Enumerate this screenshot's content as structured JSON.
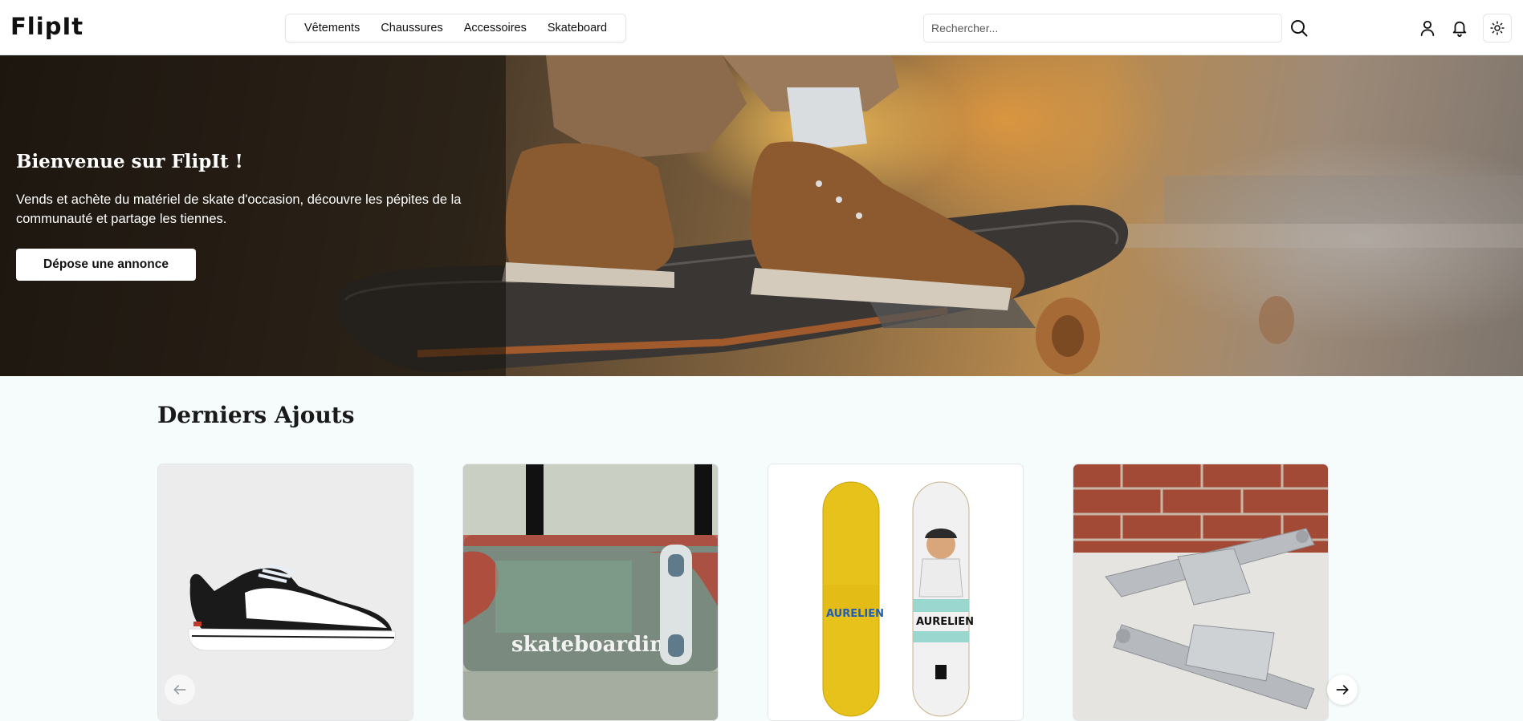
{
  "header": {
    "logo": "FlipIt",
    "nav": [
      "Vêtements",
      "Chaussures",
      "Accessoires",
      "Skateboard"
    ],
    "search": {
      "placeholder": "Rechercher..."
    },
    "icons": [
      "search-icon",
      "user-icon",
      "bell-icon",
      "sun-icon"
    ]
  },
  "hero": {
    "title": "Bienvenue sur FlipIt !",
    "text": "Vends et achète du matériel de skate d'occasion, découvre les pépites de la communauté et partage les tiennes.",
    "cta": "Dépose une annonce"
  },
  "latest": {
    "title": "Derniers Ajouts",
    "cards": [
      {
        "image": "sneaker",
        "alt": "shoe"
      },
      {
        "image": "skateboard-deck-graffiti",
        "alt": "skateboarding",
        "print": "skateboarding"
      },
      {
        "image": "two-skate-decks",
        "alt": "decks",
        "print": [
          "AURELIEN",
          "AURELIEN"
        ]
      },
      {
        "image": "skate-trucks",
        "alt": "trucks"
      }
    ],
    "controls": [
      "arrow-left-icon",
      "arrow-right-icon"
    ]
  },
  "colors": {
    "accent": "#111111",
    "background": "#f6fbfc",
    "overlay": "#120e0a"
  }
}
